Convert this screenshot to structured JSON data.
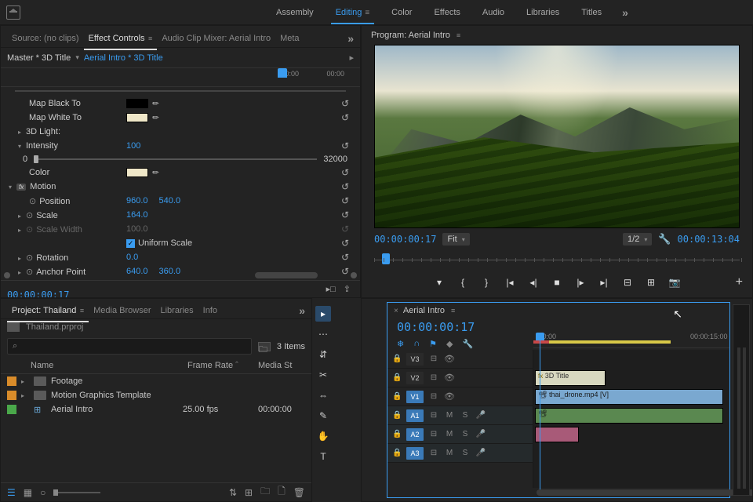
{
  "topbar": {
    "workspaces": [
      "Assembly",
      "Editing",
      "Color",
      "Effects",
      "Audio",
      "Libraries",
      "Titles"
    ],
    "active": 1,
    "overflow": "»"
  },
  "source_panel": {
    "tabs": [
      "Source: (no clips)",
      "Effect Controls",
      "Audio Clip Mixer: Aerial Intro",
      "Meta"
    ],
    "active": 1,
    "master_label": "Master * 3D Title",
    "clip_label": "Aerial Intro * 3D Title",
    "ruler": {
      "t0": ":00:00",
      "t1": "00:00"
    },
    "rows": {
      "map_black": "Map Black To",
      "map_white": "Map White To",
      "light": "3D Light:",
      "intensity": "Intensity",
      "intensity_val": "100",
      "slider_min": "0",
      "slider_max": "32000",
      "color": "Color",
      "motion": "Motion",
      "position": "Position",
      "pos_x": "960.0",
      "pos_y": "540.0",
      "scale": "Scale",
      "scale_val": "164.0",
      "scale_w": "Scale Width",
      "scale_w_val": "100.0",
      "uniform": "Uniform Scale",
      "rotation": "Rotation",
      "rotation_val": "0.0",
      "anchor": "Anchor Point",
      "anchor_x": "640.0",
      "anchor_y": "360.0"
    },
    "time": "00:00:00:17"
  },
  "program": {
    "label": "Program: Aerial Intro",
    "time_left": "00:00:00:17",
    "fit": "Fit",
    "zoom": "1/2",
    "time_right": "00:00:13:04"
  },
  "project": {
    "tabs": [
      "Project: Thailand",
      "Media Browser",
      "Libraries",
      "Info"
    ],
    "active": 0,
    "file": "Thailand.prproj",
    "items_count": "3 Items",
    "cols": {
      "name": "Name",
      "fr": "Frame Rate",
      "ms": "Media St"
    },
    "rows": [
      {
        "color": "orange",
        "type": "bin",
        "name": "Footage",
        "fr": "",
        "ms": ""
      },
      {
        "color": "orange",
        "type": "bin",
        "name": "Motion Graphics Template",
        "fr": "",
        "ms": ""
      },
      {
        "color": "green",
        "type": "seq",
        "name": "Aerial Intro",
        "fr": "25.00 fps",
        "ms": "00:00:00"
      }
    ],
    "search_placeholder": "⌕"
  },
  "timeline": {
    "seq": "Aerial Intro",
    "time": "00:00:00:17",
    "ruler": {
      "t0": ":00:00",
      "t1": "00:00:15:00"
    },
    "tracks": {
      "v3": "V3",
      "v2": "V2",
      "v1": "V1",
      "a1": "A1",
      "a2": "A2",
      "a3": "A3"
    },
    "clips": {
      "title": "3D Title",
      "video": "thai_drone.mp4 [V]"
    }
  },
  "tools": [
    "▸",
    "⋯",
    "⇵",
    "✂",
    "⇔",
    "✎",
    "✋",
    "T"
  ]
}
